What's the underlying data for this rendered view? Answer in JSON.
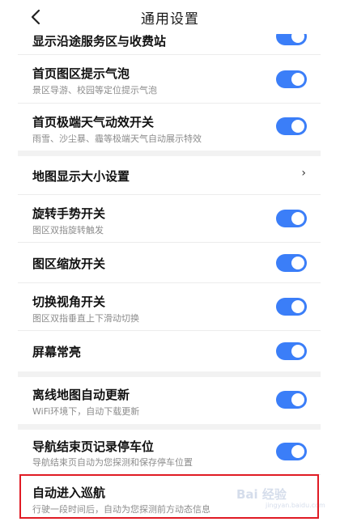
{
  "header": {
    "title": "通用设置"
  },
  "colors": {
    "toggle_on": "#3b7ef8",
    "highlight_border": "#e01b24",
    "section_gap": "#f2f2f2"
  },
  "rows": [
    {
      "title": "显示沿途服务区与收费站",
      "sub": "",
      "toggle": true,
      "control": "toggle"
    },
    {
      "title": "首页图区提示气泡",
      "sub": "景区导游、校园等定位提示气泡",
      "toggle": true,
      "control": "toggle"
    },
    {
      "title": "首页极端天气动效开关",
      "sub": "雨雪、沙尘暴、霾等极端天气自动展示特效",
      "toggle": true,
      "control": "toggle"
    },
    {
      "title": "地图显示大小设置",
      "sub": "",
      "toggle": false,
      "control": "chevron",
      "chevron": "›"
    },
    {
      "title": "旋转手势开关",
      "sub": "图区双指旋转触发",
      "toggle": true,
      "control": "toggle"
    },
    {
      "title": "图区缩放开关",
      "sub": "",
      "toggle": true,
      "control": "toggle"
    },
    {
      "title": "切换视角开关",
      "sub": "图区双指垂直上下滑动切换",
      "toggle": true,
      "control": "toggle"
    },
    {
      "title": "屏幕常亮",
      "sub": "",
      "toggle": true,
      "control": "toggle"
    },
    {
      "title": "离线地图自动更新",
      "sub": "WiFi环境下，自动下载更新",
      "toggle": true,
      "control": "toggle"
    },
    {
      "title": "导航结束页记录停车位",
      "sub": "导航结束页自动为您探测和保存停车位置",
      "toggle": true,
      "control": "toggle"
    },
    {
      "title": "自动进入巡航",
      "sub": "行驶一段时间后，自动为您探测前方动态信息",
      "toggle": false,
      "control": "none"
    }
  ],
  "watermark": {
    "text": "Bai 经验",
    "sub": "jingyan.baidu.com"
  }
}
